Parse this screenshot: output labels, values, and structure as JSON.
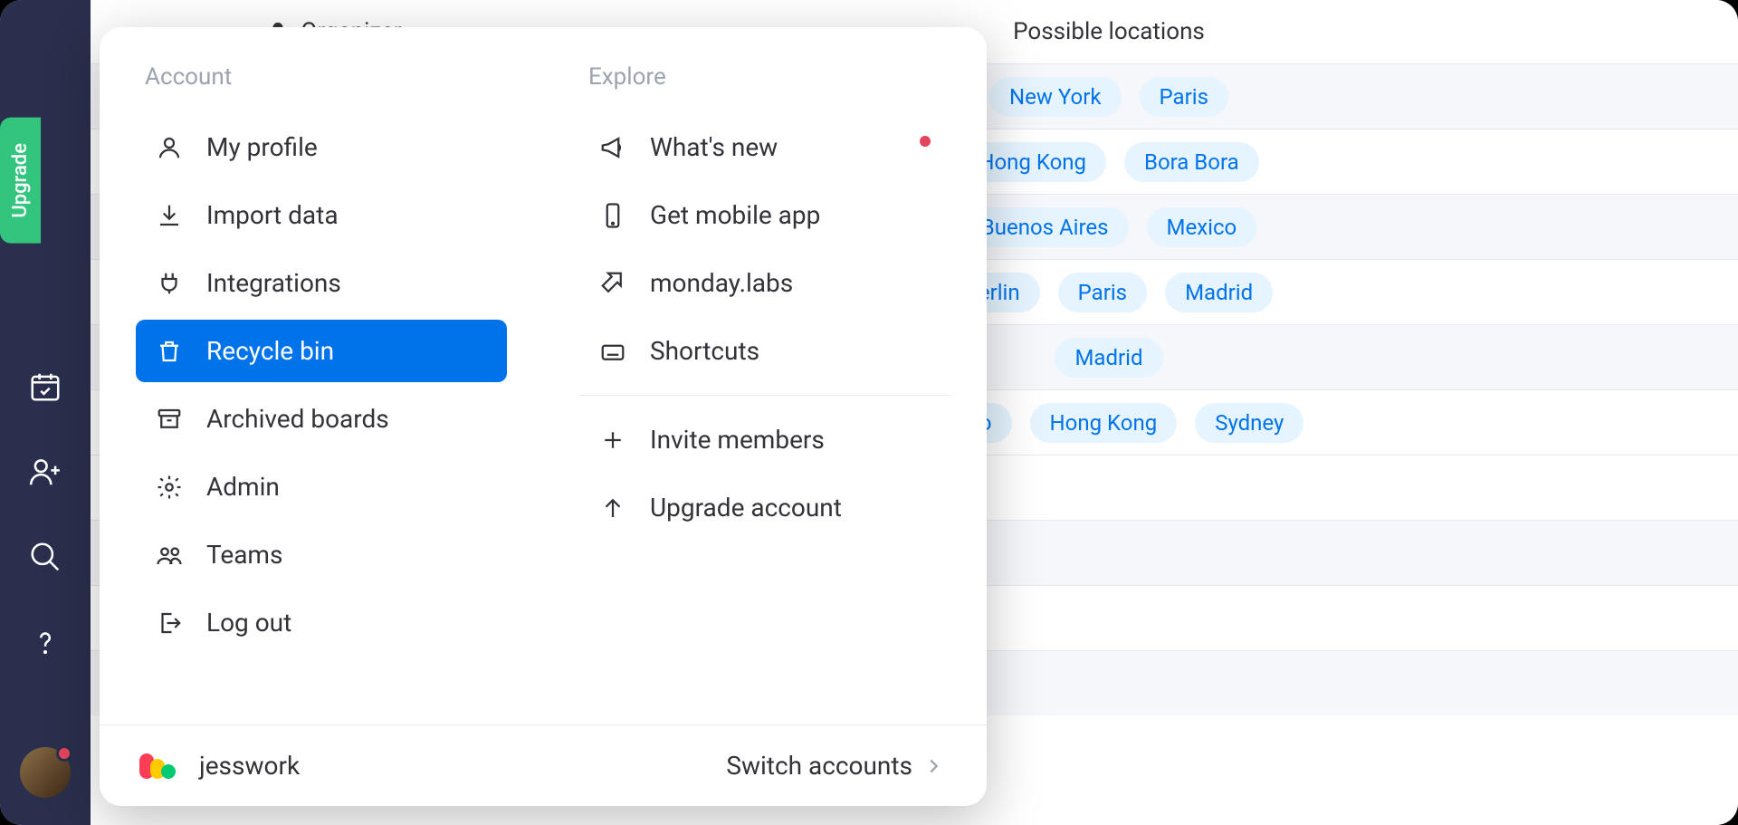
{
  "leftRail": {
    "upgrade": "Upgrade"
  },
  "flyout": {
    "accountHeading": "Account",
    "exploreHeading": "Explore",
    "accountItems": {
      "profile": "My profile",
      "import": "Import data",
      "integrations": "Integrations",
      "recycle": "Recycle bin",
      "archived": "Archived boards",
      "admin": "Admin",
      "teams": "Teams",
      "logout": "Log out"
    },
    "exploreItems": {
      "whatsnew": "What's new",
      "mobile": "Get mobile app",
      "labs": "monday.labs",
      "shortcuts": "Shortcuts",
      "invite": "Invite members",
      "upgrade": "Upgrade account"
    },
    "workspace": "jesswork",
    "switchAccounts": "Switch accounts"
  },
  "board": {
    "columns": {
      "organizer": "Organizer",
      "locations": "Possible locations"
    },
    "rows": [
      {
        "avatar": "flower",
        "locations": [
          "New York",
          "Paris"
        ]
      },
      {
        "avatar": "person1",
        "locations": [
          "Hong Kong",
          "Bora Bora"
        ]
      },
      {
        "avatar": "person2",
        "locations": [
          "Buenos Aires",
          "Mexico"
        ]
      },
      {
        "avatar": "person2",
        "locations": [
          "Berlin",
          "Paris",
          "Madrid"
        ]
      },
      {
        "avatar": "flower",
        "locations": [
          "Madrid"
        ]
      },
      {
        "avatar": "person2",
        "locations": [
          "Tokyo",
          "Hong Kong",
          "Sydney"
        ]
      }
    ]
  }
}
